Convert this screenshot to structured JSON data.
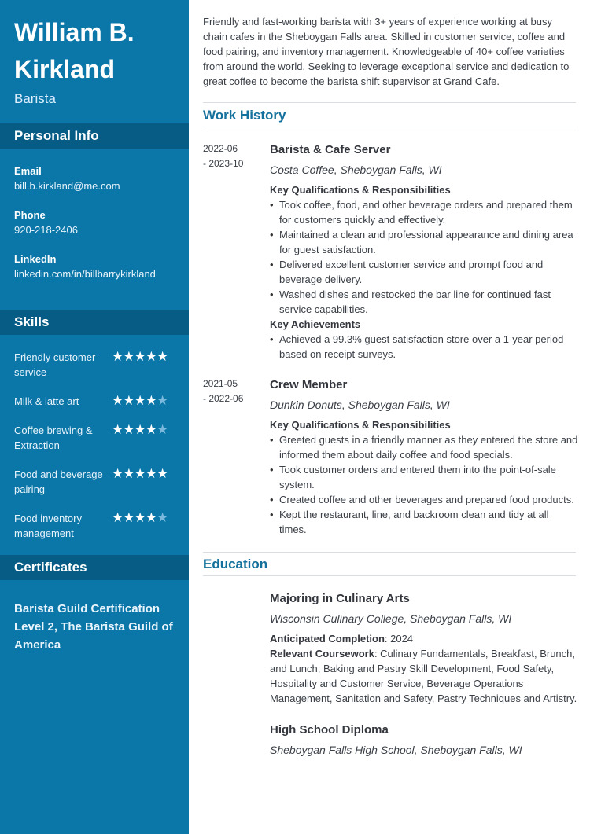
{
  "header": {
    "name": "William B. Kirkland",
    "role": "Barista"
  },
  "sidebar": {
    "personal_info_title": "Personal Info",
    "contacts": [
      {
        "label": "Email",
        "value": "bill.b.kirkland@me.com"
      },
      {
        "label": "Phone",
        "value": "920-218-2406"
      },
      {
        "label": "LinkedIn",
        "value": "linkedin.com/in/billbarrykirkland"
      }
    ],
    "skills_title": "Skills",
    "skills": [
      {
        "name": "Friendly customer service",
        "rating": 5,
        "max": 5
      },
      {
        "name": "Milk & latte art",
        "rating": 4,
        "max": 5
      },
      {
        "name": "Coffee brewing & Extraction",
        "rating": 4,
        "max": 5
      },
      {
        "name": "Food and beverage pairing",
        "rating": 5,
        "max": 5
      },
      {
        "name": "Food inventory management",
        "rating": 4,
        "max": 5
      }
    ],
    "certificates_title": "Certificates",
    "certificates": [
      "Barista Guild Certification Level 2, The Barista Guild of America"
    ]
  },
  "summary": "Friendly and fast-working barista with 3+ years of experience working at busy chain cafes in the Sheboygan Falls area. Skilled in customer service, coffee and food pairing, and inventory management. Knowledgeable of 40+ coffee varieties from around the world. Seeking to leverage exceptional service and dedication to great coffee to become the barista shift supervisor at Grand Cafe.",
  "work_history": {
    "title": "Work History",
    "jobs": [
      {
        "date_start": "2022-06",
        "date_end": "- 2023-10",
        "title": "Barista & Cafe Server",
        "company": "Costa Coffee, Sheboygan Falls, WI",
        "responsibilities_title": "Key Qualifications & Responsibilities",
        "responsibilities": [
          "Took coffee, food, and other beverage orders and prepared them for customers quickly and effectively.",
          "Maintained a clean and professional appearance and dining area for guest satisfaction.",
          "Delivered excellent customer service and prompt food and beverage delivery.",
          "Washed dishes and restocked the bar line for continued fast service capabilities."
        ],
        "achievements_title": "Key Achievements",
        "achievements": [
          "Achieved a 99.3% guest satisfaction store over a 1-year period based on receipt surveys."
        ]
      },
      {
        "date_start": "2021-05",
        "date_end": "- 2022-06",
        "title": "Crew Member",
        "company": "Dunkin Donuts, Sheboygan Falls, WI",
        "responsibilities_title": "Key Qualifications & Responsibilities",
        "responsibilities": [
          "Greeted guests in a friendly manner as they entered the store and informed them about daily coffee and food specials.",
          "Took customer orders and entered them into the point-of-sale system.",
          "Created coffee and other beverages and prepared food products.",
          "Kept the restaurant, line, and backroom clean and tidy at all times."
        ]
      }
    ]
  },
  "education": {
    "title": "Education",
    "items": [
      {
        "degree": "Majoring in Culinary Arts",
        "school": "Wisconsin Culinary College, Sheboygan Falls, WI",
        "completion_label": "Anticipated Completion",
        "completion_value": ": 2024",
        "coursework_label": "Relevant Coursework",
        "coursework_value": ": Culinary Fundamentals, Breakfast, Brunch, and Lunch, Baking and Pastry Skill Development, Food Safety, Hospitality and Customer Service, Beverage Operations Management, Sanitation and Safety, Pastry Techniques and Artistry."
      },
      {
        "degree": "High School Diploma",
        "school": "Sheboygan Falls High School, Sheboygan Falls, WI"
      }
    ]
  },
  "colors": {
    "sidebar": "#0b76a8",
    "sidebar_header": "#075c86",
    "accent": "#14709c",
    "star_off": "#7ab9dc"
  }
}
